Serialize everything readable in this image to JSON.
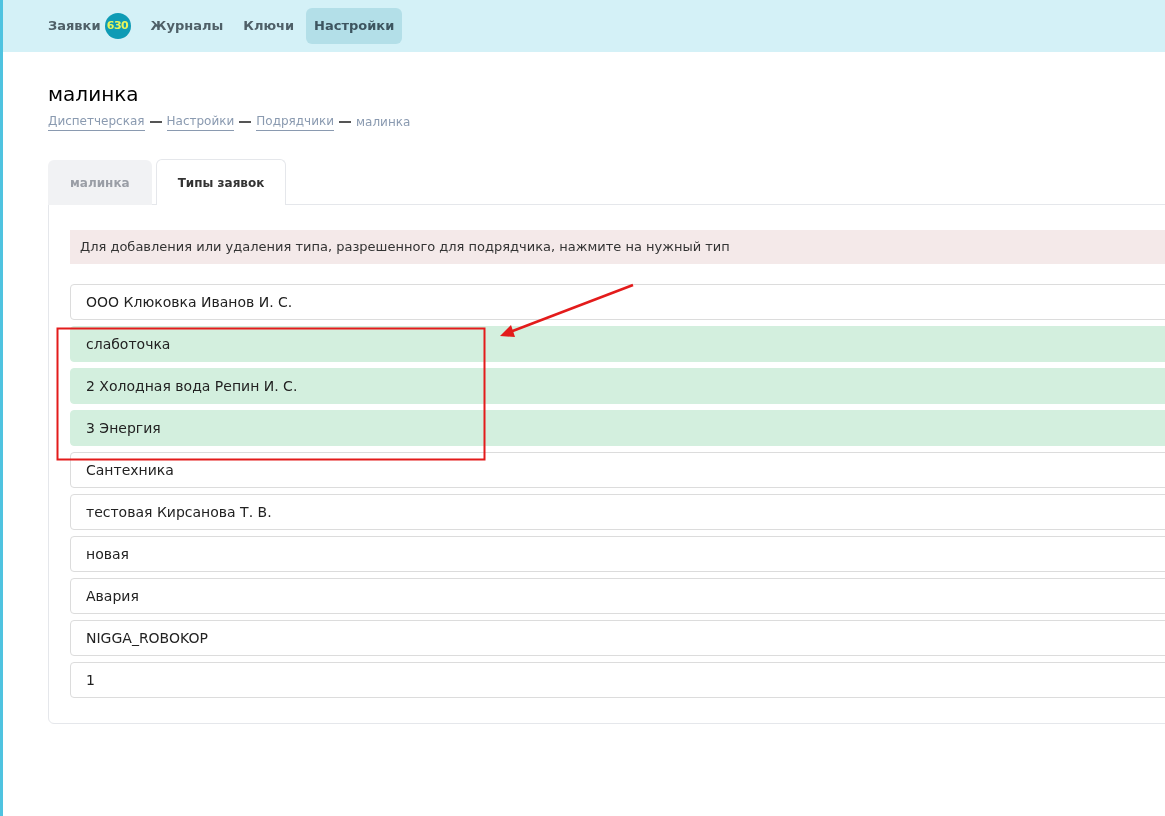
{
  "nav": [
    {
      "label": "Заявки",
      "badge": "630",
      "selected": false
    },
    {
      "label": "Журналы",
      "selected": false
    },
    {
      "label": "Ключи",
      "selected": false
    },
    {
      "label": "Настройки",
      "selected": true
    }
  ],
  "title": "малинка",
  "breadcrumb": [
    {
      "label": "Диспетчерская",
      "link": true
    },
    {
      "label": "Настройки",
      "link": true
    },
    {
      "label": "Подрядчики",
      "link": true
    },
    {
      "label": "малинка",
      "link": false
    }
  ],
  "tabs": [
    {
      "label": "малинка",
      "selected": false
    },
    {
      "label": "Типы заявок",
      "selected": true
    }
  ],
  "notice": "Для добавления или удаления типа, разрешенного для подрядчика, нажмите на нужный тип",
  "types": [
    {
      "label": "ООО Клюковка Иванов И. С.",
      "selected": false
    },
    {
      "label": "слаботочка",
      "selected": true
    },
    {
      "label": "2 Холодная вода Репин И. С.",
      "selected": true
    },
    {
      "label": "3 Энергия",
      "selected": true
    },
    {
      "label": "Сантехника",
      "selected": false
    },
    {
      "label": "тестовая Кирсанова Т. В.",
      "selected": false
    },
    {
      "label": "новая",
      "selected": false
    },
    {
      "label": "Авария",
      "selected": false
    },
    {
      "label": "NIGGA_ROBOKOP",
      "selected": false
    },
    {
      "label": "1",
      "selected": false
    }
  ]
}
